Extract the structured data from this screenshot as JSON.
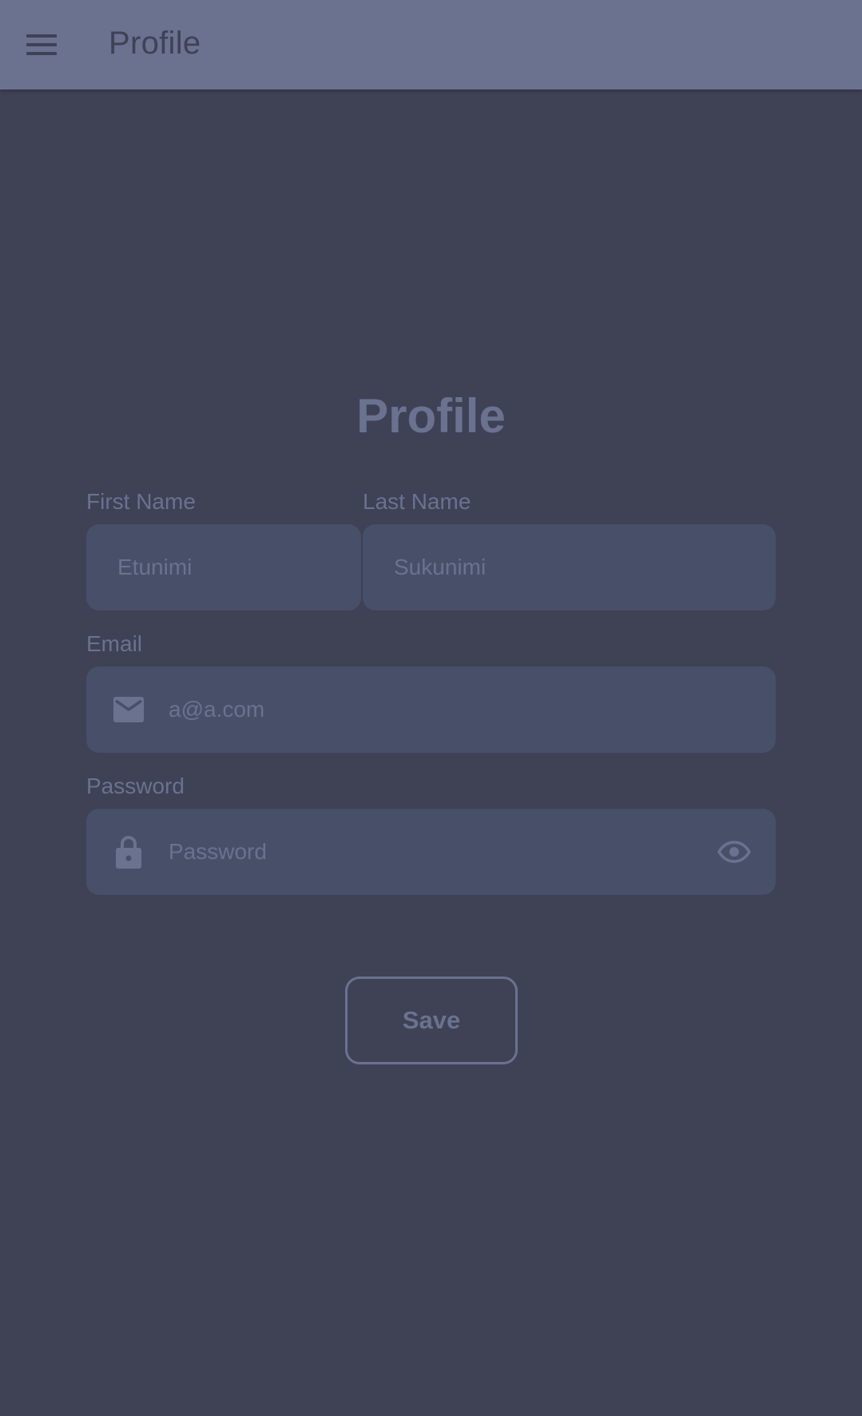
{
  "app_bar": {
    "title": "Profile"
  },
  "form": {
    "title": "Profile",
    "first_name": {
      "label": "First Name",
      "value": "Etunimi"
    },
    "last_name": {
      "label": "Last Name",
      "value": "Sukunimi"
    },
    "email": {
      "label": "Email",
      "value": "a@a.com",
      "icon": "mail-icon"
    },
    "password": {
      "label": "Password",
      "placeholder": "Password",
      "icon": "lock-icon",
      "toggle_icon": "eye-icon"
    },
    "save_label": "Save"
  },
  "colors": {
    "background": "#3f4155",
    "app_bar": "#6a7290",
    "field_fill": "#474f69",
    "text_muted": "#6a7290"
  }
}
